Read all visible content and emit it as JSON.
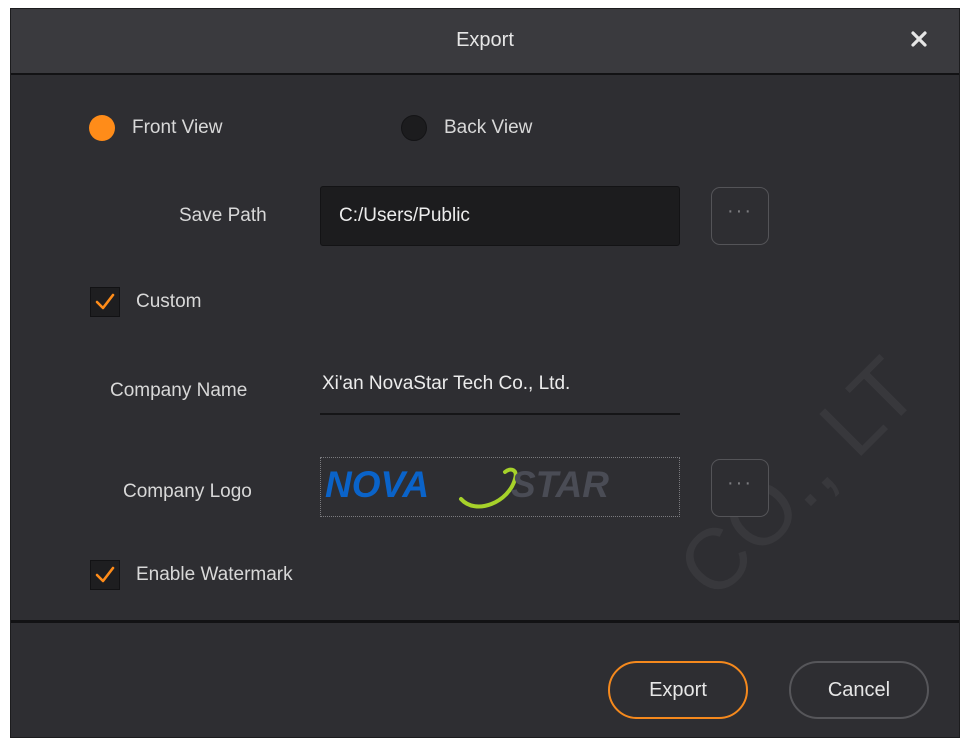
{
  "dialog": {
    "title": "Export"
  },
  "view_options": [
    {
      "label": "Front View",
      "selected": true
    },
    {
      "label": "Back View",
      "selected": false
    }
  ],
  "save_path": {
    "label": "Save Path",
    "value": "C:/Users/Public",
    "browse_label": "···"
  },
  "custom": {
    "label": "Custom",
    "checked": true
  },
  "company_name": {
    "label": "Company Name",
    "value": "Xi'an NovaStar Tech Co., Ltd."
  },
  "company_logo": {
    "label": "Company Logo",
    "browse_label": "···",
    "logo_text_left": "NOVA",
    "logo_text_right": "STAR"
  },
  "watermark_option": {
    "label": "Enable Watermark",
    "checked": true
  },
  "buttons": {
    "export": "Export",
    "cancel": "Cancel"
  },
  "watermark_text": "CO., LT",
  "colors": {
    "accent": "#ff8c19",
    "background": "#2e2e32",
    "field": "#1c1c1e",
    "logo_blue": "#0a63c9",
    "logo_gray": "#4a4c55",
    "logo_green": "#a6d22a"
  }
}
